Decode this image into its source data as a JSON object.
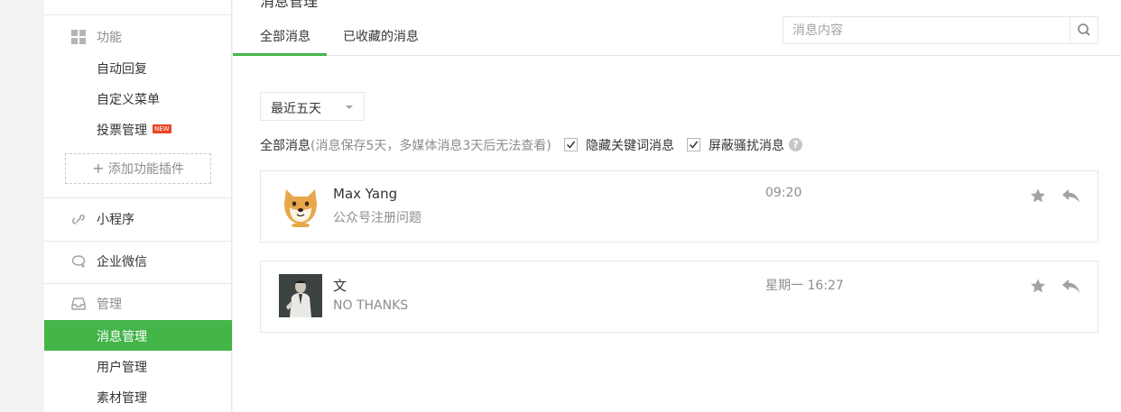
{
  "sidebar": {
    "features_group": "功能",
    "features": [
      "自动回复",
      "自定义菜单",
      "投票管理"
    ],
    "new_badge": "NEW",
    "add_plugin": "添加功能插件",
    "miniprogram": "小程序",
    "wecom": "企业微信",
    "manage_group": "管理",
    "manage": [
      "消息管理",
      "用户管理",
      "素材管理"
    ],
    "active_item": "消息管理",
    "accent_color": "#44b549"
  },
  "main": {
    "page_title": "消息管理",
    "tabs": [
      "全部消息",
      "已收藏的消息"
    ],
    "active_tab": "全部消息",
    "search": {
      "placeholder": "消息内容",
      "icon": "search-icon"
    },
    "date_filter": {
      "selected": "最近五天"
    },
    "filter_row": {
      "label": "全部消息",
      "note": "(消息保存5天，多媒体消息3天后无法查看)",
      "options": [
        {
          "label": "隐藏关键词消息",
          "checked": true
        },
        {
          "label": "屏蔽骚扰消息",
          "checked": true
        }
      ],
      "help_glyph": "?"
    },
    "messages": [
      {
        "name": "Max Yang",
        "text": "公众号注册问题",
        "time": "09:20",
        "avatar": "doge-avatar"
      },
      {
        "name": "文",
        "text": "NO THANKS",
        "time": "星期一 16:27",
        "avatar": "person-photo-avatar"
      }
    ]
  }
}
